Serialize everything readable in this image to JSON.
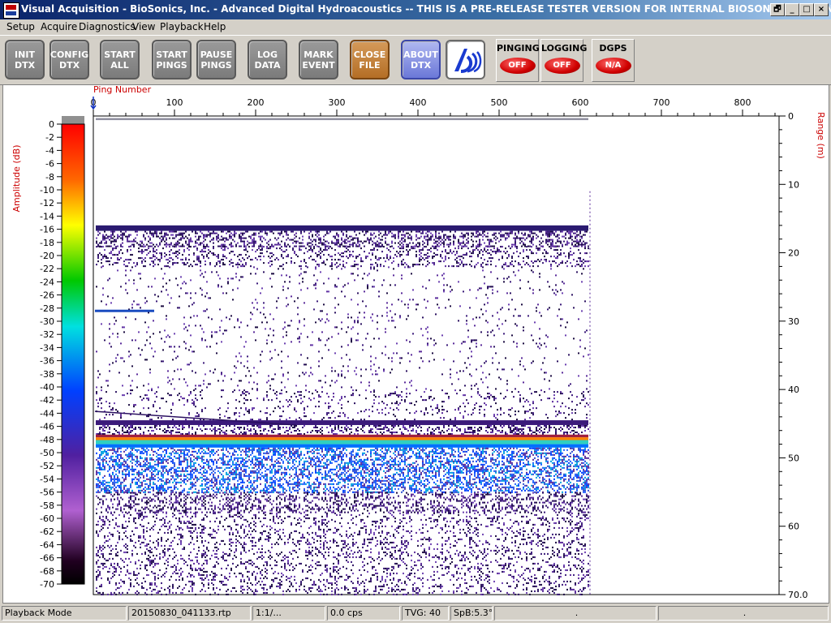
{
  "window": {
    "title": "Visual Acquisition  -  BioSonics, Inc.  -  Advanced Digital Hydroacoustics  -- THIS IS A PRE-RELEASE TESTER VERSION FOR INTERNAL BIOSONICS USE ONLY",
    "icon": "dtx-app-icon",
    "controls": {
      "restore": "🗗",
      "minimize": "_",
      "maximize": "□",
      "close": "×"
    }
  },
  "menu": [
    "Setup",
    "Acquire",
    "Diagnostics",
    "View",
    "Playback",
    "Help"
  ],
  "toolbar": {
    "buttons": [
      "INIT\nDTX",
      "CONFIG\nDTX",
      "START\nALL",
      "START\nPINGS",
      "PAUSE\nPINGS",
      "LOG\nDATA",
      "MARK\nEVENT",
      "CLOSE\nFILE",
      "ABOUT\nDTX"
    ],
    "logo": "biosonics-logo-icon",
    "indicators": [
      {
        "label": "PINGING",
        "state": "OFF"
      },
      {
        "label": "LOGGING",
        "state": "OFF"
      },
      {
        "label": "DGPS",
        "state": "N/A"
      }
    ]
  },
  "echogram": {
    "x_axis_label": "Ping Number",
    "x_ticks": [
      "0",
      "100",
      "200",
      "300",
      "400",
      "500",
      "600",
      "700",
      "800"
    ],
    "y_axis_label": "Range (m)",
    "y_ticks": [
      "0",
      "10",
      "20",
      "30",
      "40",
      "50",
      "60",
      "70.0"
    ],
    "amplitude_label": "Amplitude (dB)",
    "amplitude_ticks": [
      "0",
      "-2",
      "-4",
      "-6",
      "-8",
      "-10",
      "-12",
      "-14",
      "-16",
      "-18",
      "-20",
      "-22",
      "-24",
      "-26",
      "-28",
      "-30",
      "-32",
      "-34",
      "-36",
      "-38",
      "-40",
      "-42",
      "-44",
      "-46",
      "-48",
      "-50",
      "-52",
      "-54",
      "-56",
      "-58",
      "-60",
      "-62",
      "-64",
      "-66",
      "-68",
      "-70"
    ],
    "pings_recorded": 610,
    "bottom_depth_m": 47,
    "axis_color": "#cc0000"
  },
  "status": {
    "mode": "Playback Mode",
    "file": "20150830_041133.rtp",
    "ratio": "1:1/...",
    "cps": "0.0 cps",
    "tvg": "TVG: 40",
    "spb": "SpB:5.3°",
    "extra1": ".",
    "extra2": "."
  }
}
